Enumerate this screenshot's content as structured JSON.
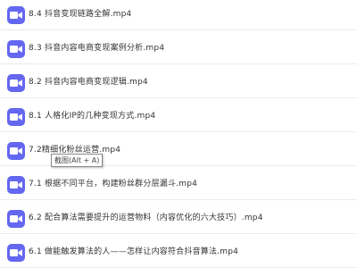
{
  "file_list": {
    "items": [
      {
        "name": "8.4 抖音变现链路全解.mp4",
        "icon": "video-file-icon"
      },
      {
        "name": "8.3 抖音内容电商变现案例分析.mp4",
        "icon": "video-file-icon"
      },
      {
        "name": "8.2 抖音内容电商变现逻辑.mp4",
        "icon": "video-file-icon"
      },
      {
        "name": "8.1 人格化IP的几种变现方式.mp4",
        "icon": "video-file-icon"
      },
      {
        "name": "7.2精细化粉丝运营.mp4",
        "icon": "video-file-icon"
      },
      {
        "name": "7.1 根据不同平台，构建粉丝群分层漏斗.mp4",
        "icon": "video-file-icon"
      },
      {
        "name": "6.2 配合算法需要提升的运营物料（内容优化的六大技巧）.mp4",
        "icon": "video-file-icon"
      },
      {
        "name": "6.1 做能触发算法的人——怎样让内容符合抖音算法.mp4",
        "icon": "video-file-icon"
      }
    ]
  },
  "tooltip": {
    "text": "截图(Alt + A)"
  },
  "colors": {
    "icon_bg": "#6467f0",
    "icon_fg": "#ffffff",
    "text": "#333333",
    "divider": "#ececec"
  }
}
